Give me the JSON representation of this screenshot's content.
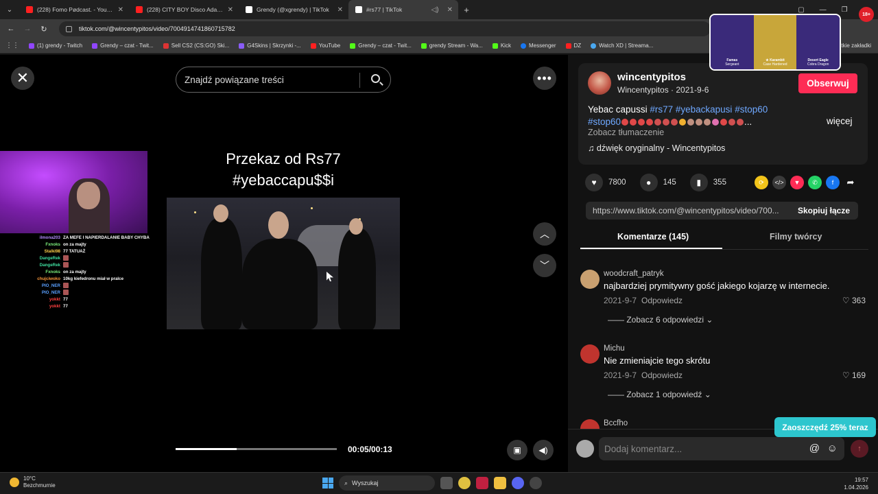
{
  "browser": {
    "tabs": [
      {
        "title": "(228) Fomo Pødcast. - YouTube",
        "color": "#ff2020"
      },
      {
        "title": "(228) CITY BOY Disco Adamus I",
        "color": "#ff2020"
      },
      {
        "title": "Grendy (@xgrendy) | TikTok",
        "color": "#ffffff"
      },
      {
        "title": "#rs77 | TikTok",
        "color": "#ffffff"
      }
    ],
    "url": "tiktok.com/@wincentypitos/video/7004914741860715782",
    "bookmarks": [
      {
        "label": "(1) grendy - Twitch",
        "color": "#9146ff"
      },
      {
        "label": "Grendy – czat - Twit...",
        "color": "#9146ff"
      },
      {
        "label": "Sell CS2 (CS:GO) Ski...",
        "color": "#d33"
      },
      {
        "label": "G4Skins | Skrzynki -...",
        "color": "#8a5cf6"
      },
      {
        "label": "YouTube",
        "color": "#ff2020"
      },
      {
        "label": "Grendy – czat - Twit...",
        "color": "#53fc18"
      },
      {
        "label": "grendy Stream - Wa...",
        "color": "#53fc18"
      },
      {
        "label": "Kick",
        "color": "#53fc18"
      },
      {
        "label": "Messenger",
        "color": "#1877f2"
      },
      {
        "label": "DZ",
        "color": "#ff2020"
      },
      {
        "label": "Watch XD | Streama...",
        "color": "#4aa8f0"
      }
    ],
    "bookmarks_end": "tkie zakładki"
  },
  "video": {
    "search_placeholder": "Znajdź powiązane treści",
    "caption_line1": "Przekaz od Rs77",
    "caption_line2": "#yebaccapu$$i",
    "time": "00:05/00:13",
    "progress": 0.38
  },
  "stream_chat": [
    {
      "user": "ilmona203",
      "msg": "ZA MEFE I NAPIERDALANIE BABY CHYBA",
      "color": "#b48cff"
    },
    {
      "user": "Fxnoks",
      "msg": "on za majty",
      "color": "#7df07d"
    },
    {
      "user": "Stalki98",
      "msg": "77 TATUAŻ",
      "color": "#ffd24a"
    },
    {
      "user": "DangeRek",
      "msg": "",
      "color": "#3fe0a0",
      "emote": true
    },
    {
      "user": "DangeRek",
      "msg": "",
      "color": "#3fe0a0",
      "emote": true
    },
    {
      "user": "Fxnoks",
      "msg": "on za majty",
      "color": "#7df07d"
    },
    {
      "user": "chujciwoko",
      "msg": "10kg kiefedronu miał w pralce",
      "color": "#ff9a3c"
    },
    {
      "user": "PIO_NER",
      "msg": "",
      "color": "#5aa0ff",
      "emote": true
    },
    {
      "user": "PIO_NER",
      "msg": "",
      "color": "#5aa0ff",
      "emote": true
    },
    {
      "user": "yokkt",
      "msg": "77",
      "color": "#ff4040"
    },
    {
      "user": "yokkt",
      "msg": "77",
      "color": "#ff4040"
    }
  ],
  "post": {
    "username": "wincentypitos",
    "subline": "Wincentypitos · 2021-9-6",
    "follow": "Obserwuj",
    "desc_text": "Yebac capussi ",
    "tags1": [
      "#rs77",
      "#yebackapusi",
      "#stop60"
    ],
    "tag2": "#stop60",
    "ellipsis": "...",
    "more": "więcej",
    "translate": "Zobacz tłumaczenie",
    "sound": "♫  dźwięk oryginalny - Wincentypitos",
    "likes": "7800",
    "comments_count": "145",
    "saves": "355",
    "link": "https://www.tiktok.com/@wincentypitos/video/700...",
    "copy": "Skopiuj łącze",
    "tab_comments": "Komentarze (145)",
    "tab_creator": "Filmy twórcy"
  },
  "comments": [
    {
      "user": "woodcraft_patryk",
      "text": "najbardziej prymitywny gość jakiego kojarzę w internecie.",
      "date": "2021-9-7",
      "reply": "Odpowiedz",
      "likes": "363",
      "view": "Zobacz 6 odpowiedzi",
      "color": "#c9a070"
    },
    {
      "user": "Michu",
      "text": "Nie zmieniajcie tego skrótu",
      "date": "2021-9-7",
      "reply": "Odpowiedz",
      "likes": "169",
      "view": "Zobacz 1 odpowiedź",
      "color": "#c0342e"
    },
    {
      "user": "Bccfho",
      "text": "",
      "date": "",
      "reply": "",
      "likes": "",
      "view": "",
      "color": "#c0342e"
    }
  ],
  "comment_bar": {
    "placeholder": "Dodaj komentarz...",
    "promo": "Zaoszczędź 25% teraz"
  },
  "ad": {
    "items": [
      "Famas",
      "★ Karambit",
      "Desert Eagle"
    ],
    "subs": [
      "Sergeant",
      "Case Hardened",
      "Cobra Dragon"
    ],
    "badge": "18+"
  },
  "taskbar": {
    "temp": "10°C",
    "weather": "Bezchmurnie",
    "search": "Wyszukaj",
    "time": "19:57",
    "date": "1.04.2026"
  }
}
